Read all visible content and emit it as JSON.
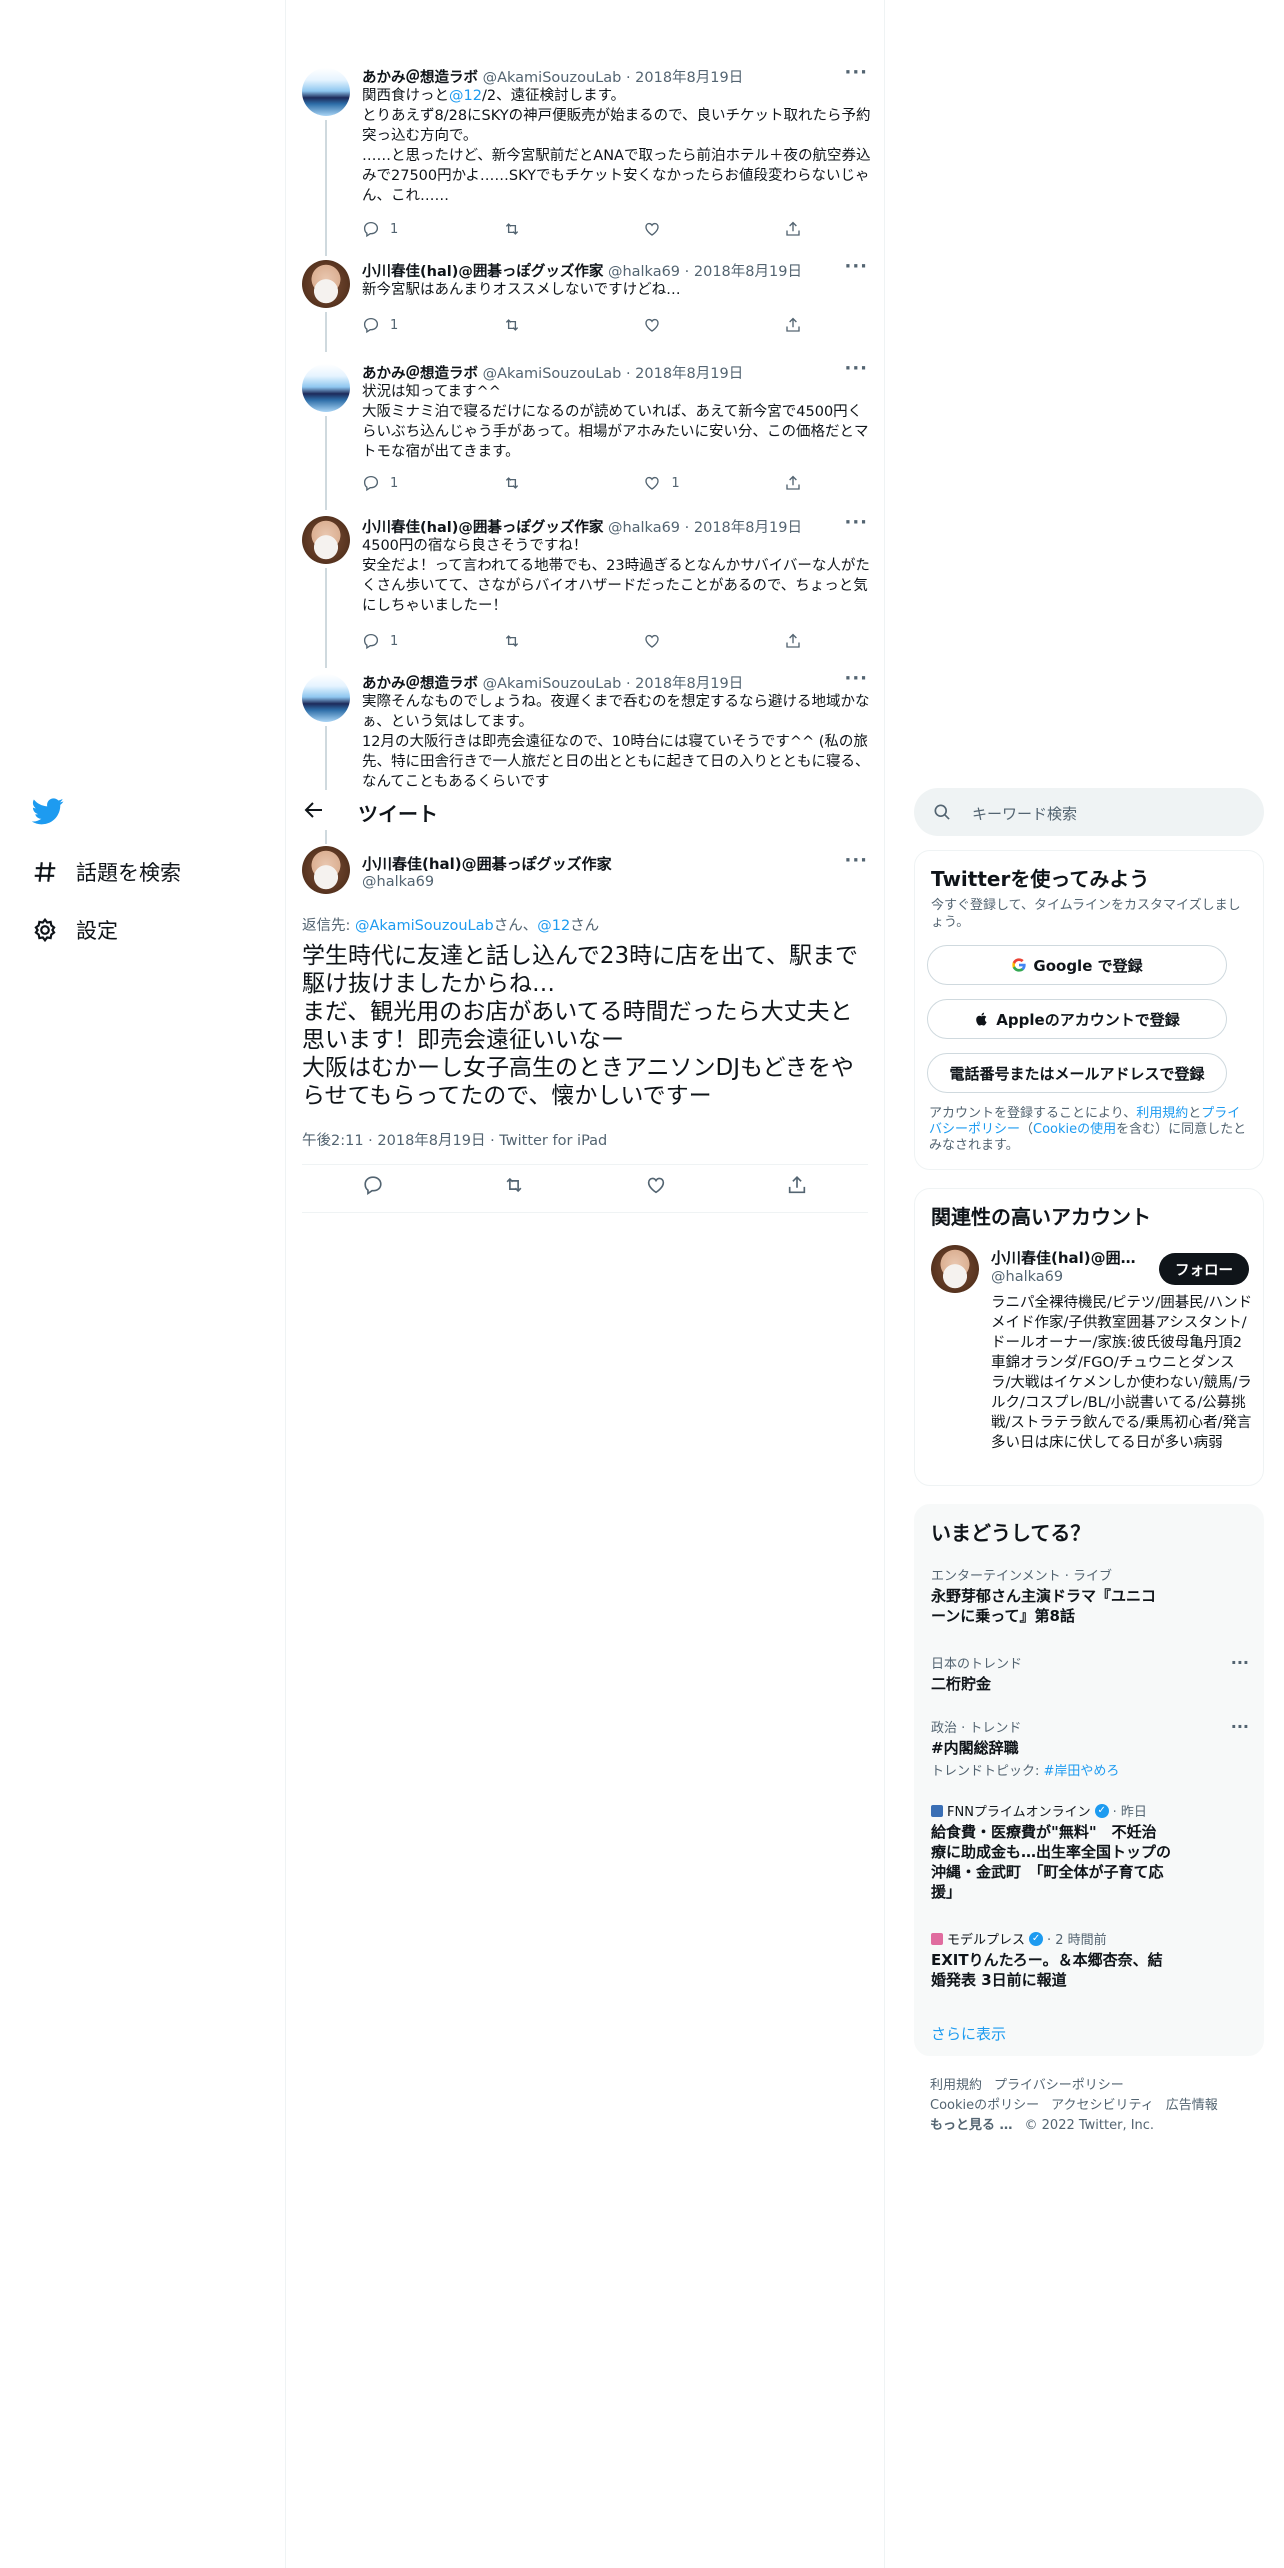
{
  "nav": {
    "items": [
      {
        "label": "話題を検索",
        "icon": "hashtag-icon"
      },
      {
        "label": "設定",
        "icon": "gear-icon"
      }
    ]
  },
  "thread": [
    {
      "display_name": "あかみ＠想造ラボ",
      "handle": "@AkamiSouzouLab",
      "date": "· 2018年8月19日",
      "text_pre": "関西食けっと",
      "mention": "@12",
      "text_post": "/2、遠征検討します。\nとりあえず8/28にSKYの神戸便販売が始まるので、良いチケット取れたら予約突っ込む方向で。\n……と思ったけど、新今宮駅前だとANAで取ったら前泊ホテル＋夜の航空券込みで27500円かよ……SKYでもチケット安くなかったらお値段変わらないじゃん、これ……",
      "reply_count": "1",
      "retweet_count": "",
      "like_count": ""
    },
    {
      "display_name": "小川春佳(hal)@囲碁っぽグッズ作家",
      "handle": "@halka69",
      "date": "· 2018年8月19日",
      "text": "新今宮駅はあんまりオススメしないですけどね…",
      "reply_count": "1",
      "retweet_count": "",
      "like_count": ""
    },
    {
      "display_name": "あかみ＠想造ラボ",
      "handle": "@AkamiSouzouLab",
      "date": "· 2018年8月19日",
      "text": "状況は知ってます^^\n大阪ミナミ泊で寝るだけになるのが読めていれば、あえて新今宮で4500円くらいぶち込んじゃう手があって。相場がアホみたいに安い分、この価格だとマトモな宿が出てきます。",
      "reply_count": "1",
      "retweet_count": "",
      "like_count": "1"
    },
    {
      "display_name": "小川春佳(hal)@囲碁っぽグッズ作家",
      "handle": "@halka69",
      "date": "· 2018年8月19日",
      "text": "4500円の宿なら良さそうですね！\n安全だよ！って言われてる地帯でも、23時過ぎるとなんかサバイバーな人がたくさん歩いてて、さながらバイオハザードだったことがあるので、ちょっと気にしちゃいましたー！",
      "reply_count": "1",
      "retweet_count": "",
      "like_count": ""
    },
    {
      "display_name": "あかみ＠想造ラボ",
      "handle": "@AkamiSouzouLab",
      "date": "· 2018年8月19日",
      "text": "実際そんなものでしょうね。夜遅くまで呑むのを想定するなら避ける地域かなぁ、という気はしてます。\n12月の大阪行きは即売会遠征なので、10時台には寝ていそうです^^ (私の旅先、特に田舎行きで一人旅だと日の出とともに起きて日の入りとともに寝る、なんてこともあるくらいです"
    }
  ],
  "header": {
    "title": "ツイート"
  },
  "main_tweet": {
    "display_name": "小川春佳(hal)@囲碁っぽグッズ作家",
    "handle": "@halka69",
    "reply_prefix": "返信先: ",
    "reply_mention_1": "@AkamiSouzouLab",
    "reply_mid": "さん、",
    "reply_mention_2": "@12",
    "reply_suffix": "さん",
    "text": "学生時代に友達と話し込んで23時に店を出て、駅まで駆け抜けましたからね…\nまだ、観光用のお店があいてる時間だったら大丈夫と思います！即売会遠征いいなー\n大阪はむかーし女子高生のときアニソンDJもどきをやらせてもらってたので、懐かしいですー",
    "meta": "午後2:11 · 2018年8月19日 · Twitter for iPad"
  },
  "search": {
    "placeholder": "キーワード検索"
  },
  "signup": {
    "title": "Twitterを使ってみよう",
    "subtitle": "今すぐ登録して、タイムラインをカスタマイズしましょう。",
    "google": "Google で登録",
    "apple": "Appleのアカウントで登録",
    "phone": "電話番号またはメールアドレスで登録",
    "note_pre": "アカウントを登録することにより、",
    "note_terms": "利用規約",
    "note_and": "と",
    "note_privacy": "プライバシーポリシー",
    "note_cookie_pre": "（",
    "note_cookie": "Cookieの使用",
    "note_post": "を含む）に同意したとみなされます。"
  },
  "related": {
    "title": "関連性の高いアカウント",
    "name": "小川春佳(hal)@囲碁っぽグッズ作家",
    "handle": "@halka69",
    "follow": "フォロー",
    "bio": "ラニパ全裸待機民/ピテツ/囲碁民/ハンドメイド作家/子供教室囲碁アシスタント/ドールオーナー/家族:彼氏彼母亀丹頂2車錦オランダ/FGO/チュウニとダンスラ/大戦はイケメンしか使わない/競馬/ラルク/コスプレ/BL/小説書いてる/公募挑戦/ストラテラ飲んでる/乗馬初心者/発言多い日は床に伏してる日が多い病弱"
  },
  "trends": {
    "title": "いまどうしてる？",
    "items": [
      {
        "meta": "エンターテインメント · ライブ",
        "title": "永野芽郁さん主演ドラマ『ユニコーンに乗って』第8話"
      },
      {
        "meta": "日本のトレンド",
        "title": "二桁貯金"
      },
      {
        "meta": "政治 · トレンド",
        "title": "#内閣総辞職",
        "topic_label": "トレンドトピック: ",
        "topic": "#岸田やめろ"
      },
      {
        "source": "FNNプライムオンライン",
        "time": "· 昨日",
        "title": "給食費・医療費が\"無料\"　不妊治療に助成金も…出生率全国トップの沖縄・金武町　「町全体が子育て応援」"
      },
      {
        "source": "モデルプレス",
        "time": "· 2 時間前",
        "title": "EXITりんたろー。＆本郷杏奈、結婚発表 3日前に報道"
      }
    ],
    "show_more": "さらに表示"
  },
  "footer": {
    "links": [
      "利用規約",
      "プライバシーポリシー",
      "Cookieのポリシー",
      "アクセシビリティ",
      "広告情報",
      "もっと見る …",
      "© 2022 Twitter, Inc."
    ]
  },
  "colors": {
    "accent": "#1d9bf0",
    "text": "#0f1419",
    "secondary": "#536471",
    "border": "#eff3f4"
  }
}
